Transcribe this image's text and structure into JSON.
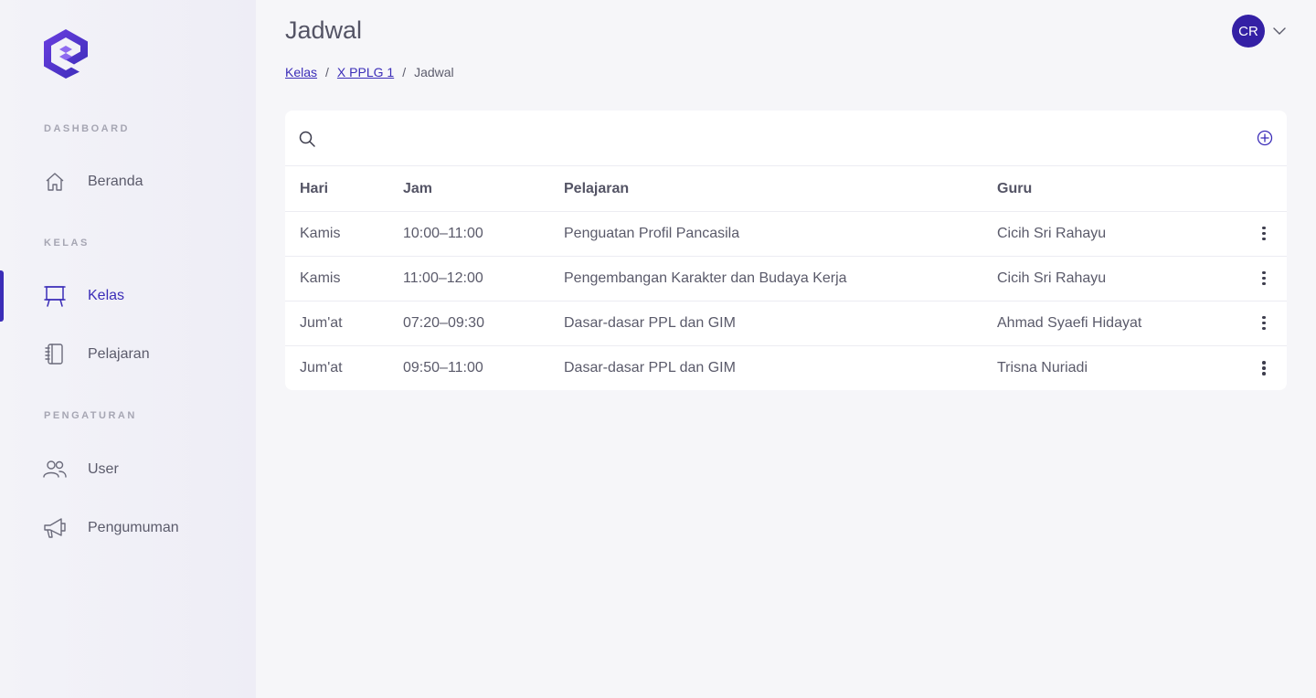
{
  "sidebar": {
    "sections": [
      {
        "label": "DASHBOARD",
        "items": [
          {
            "label": "Beranda",
            "icon": "home-icon"
          }
        ]
      },
      {
        "label": "KELAS",
        "items": [
          {
            "label": "Kelas",
            "icon": "easel-icon",
            "active": true
          },
          {
            "label": "Pelajaran",
            "icon": "notebook-icon"
          }
        ]
      },
      {
        "label": "PENGATURAN",
        "items": [
          {
            "label": "User",
            "icon": "users-icon"
          },
          {
            "label": "Pengumuman",
            "icon": "megaphone-icon"
          }
        ]
      }
    ]
  },
  "header": {
    "title": "Jadwal",
    "breadcrumb": {
      "level1": "Kelas",
      "level2": "X PPLG 1",
      "current": "Jadwal",
      "separator": "/"
    },
    "avatar_initials": "CR"
  },
  "search": {
    "placeholder": ""
  },
  "table": {
    "headers": {
      "hari": "Hari",
      "jam": "Jam",
      "pelajaran": "Pelajaran",
      "guru": "Guru"
    },
    "rows": [
      {
        "hari": "Kamis",
        "jam": "10:00–11:00",
        "pelajaran": "Penguatan Profil Pancasila",
        "guru": "Cicih Sri Rahayu"
      },
      {
        "hari": "Kamis",
        "jam": "11:00–12:00",
        "pelajaran": "Pengembangan Karakter dan Budaya Kerja",
        "guru": "Cicih Sri Rahayu"
      },
      {
        "hari": "Jum'at",
        "jam": "07:20–09:30",
        "pelajaran": "Dasar-dasar PPL dan GIM",
        "guru": "Ahmad Syaefi Hidayat"
      },
      {
        "hari": "Jum'at",
        "jam": "09:50–11:00",
        "pelajaran": "Dasar-dasar PPL dan GIM",
        "guru": "Trisna Nuriadi"
      }
    ]
  },
  "colors": {
    "accent": "#3b2db8",
    "avatar_bg": "#3420a5",
    "background": "#f6f6f9"
  }
}
